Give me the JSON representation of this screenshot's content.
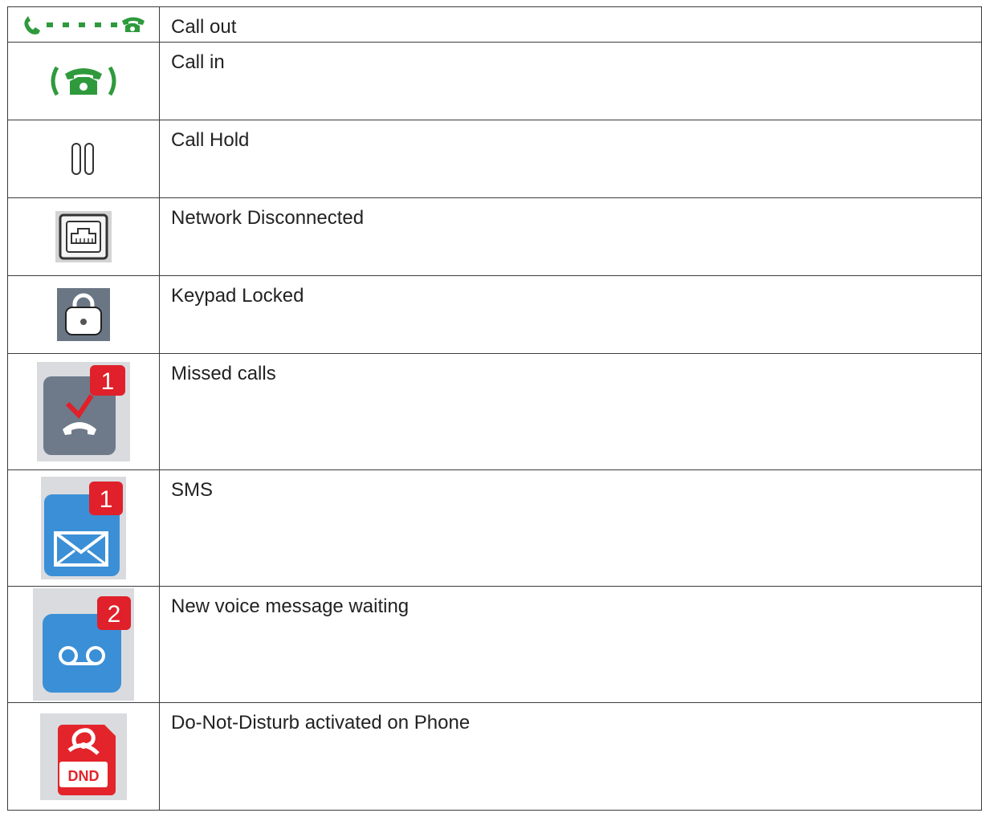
{
  "rows": [
    {
      "label": "Call out",
      "icon": "call-out-icon"
    },
    {
      "label": "Call in",
      "icon": "call-in-icon"
    },
    {
      "label": "Call Hold",
      "icon": "call-hold-icon"
    },
    {
      "label": "Network Disconnected",
      "icon": "network-disconnected-icon"
    },
    {
      "label": "Keypad Locked",
      "icon": "keypad-locked-icon"
    },
    {
      "label": "Missed calls",
      "icon": "missed-calls-icon",
      "badge": "1"
    },
    {
      "label": "SMS",
      "icon": "sms-icon",
      "badge": "1"
    },
    {
      "label": "New voice message waiting",
      "icon": "voicemail-icon",
      "badge": "2"
    },
    {
      "label": "Do-Not-Disturb activated on Phone",
      "icon": "dnd-icon",
      "badge_text": "DND"
    }
  ],
  "colors": {
    "phone_green": "#2e9a3c",
    "tile_grey": "#6e7a8a",
    "tile_blue": "#3b8fd6",
    "badge_red": "#e0202a",
    "dnd_red": "#e3242b"
  }
}
